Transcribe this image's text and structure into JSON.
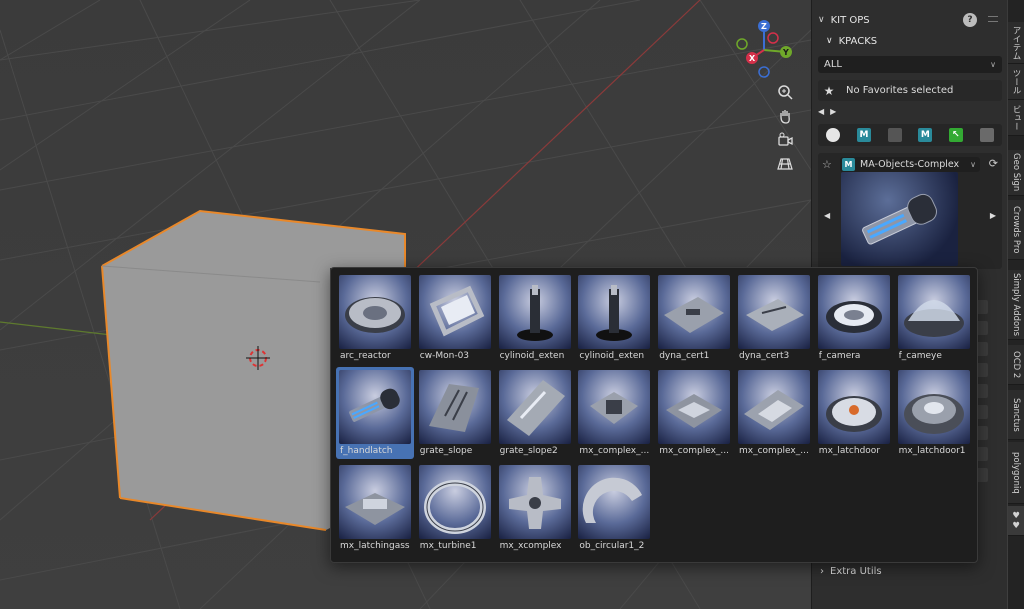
{
  "npanel": {
    "title": "KIT OPS",
    "subsection": "KPACKS",
    "filter_value": "ALL",
    "favorites_text": "No Favorites selected",
    "kpack_name": "MA-Objects-Complex",
    "kpack_badge": "M",
    "iconrow": [
      {
        "icon": "clock-icon",
        "label": "",
        "color": "#262626"
      },
      {
        "icon": "m-badge-icon",
        "label": "M",
        "color": "#2a8a9a"
      },
      {
        "icon": "grid-texture-icon",
        "label": "",
        "color": "#555555"
      },
      {
        "icon": "m-badge-icon",
        "label": "M",
        "color": "#2a8a9a"
      },
      {
        "icon": "k-arrow-icon",
        "label": "↖",
        "color": "#33aa33"
      },
      {
        "icon": "material-icon",
        "label": "",
        "color": "#6a6a6a"
      }
    ],
    "extra_utils": "Extra Utils"
  },
  "tabs": [
    {
      "label": "アイテム",
      "active": false
    },
    {
      "label": "ツール",
      "active": false
    },
    {
      "label": "ビュー",
      "active": false
    },
    {
      "label": "Geo Sign",
      "active": false
    },
    {
      "label": "Crowds Pro",
      "active": false
    },
    {
      "label": "Simply Addons",
      "active": false
    },
    {
      "label": "OCD 2",
      "active": false
    },
    {
      "label": "Sanctus",
      "active": false
    },
    {
      "label": "polygoniq",
      "active": false
    },
    {
      "label": "♥♥",
      "active": true
    }
  ],
  "gizmo": {
    "z": "Z",
    "y": "Y",
    "x": "X"
  },
  "assets": [
    {
      "label": "arc_reactor",
      "shape": "disc"
    },
    {
      "label": "cw-Mon-03",
      "shape": "frame"
    },
    {
      "label": "cylinoid_exten",
      "shape": "pillar"
    },
    {
      "label": "cylinoid_exten",
      "shape": "pillar"
    },
    {
      "label": "dyna_cert1",
      "shape": "plate"
    },
    {
      "label": "dyna_cert3",
      "shape": "plate2"
    },
    {
      "label": "f_camera",
      "shape": "lens"
    },
    {
      "label": "f_cameye",
      "shape": "dome"
    },
    {
      "label": "f_handlatch",
      "shape": "latch",
      "selected": true
    },
    {
      "label": "grate_slope",
      "shape": "grate"
    },
    {
      "label": "grate_slope2",
      "shape": "slab"
    },
    {
      "label": "mx_complex_...",
      "shape": "block"
    },
    {
      "label": "mx_complex_...",
      "shape": "block2"
    },
    {
      "label": "mx_complex_...",
      "shape": "block3"
    },
    {
      "label": "mx_latchdoor",
      "shape": "hatch"
    },
    {
      "label": "mx_latchdoor1",
      "shape": "hatch2"
    },
    {
      "label": "mx_latchingass",
      "shape": "block4"
    },
    {
      "label": "mx_turbine1",
      "shape": "ring"
    },
    {
      "label": "mx_xcomplex",
      "shape": "cross"
    },
    {
      "label": "ob_circular1_2",
      "shape": "arc"
    }
  ]
}
